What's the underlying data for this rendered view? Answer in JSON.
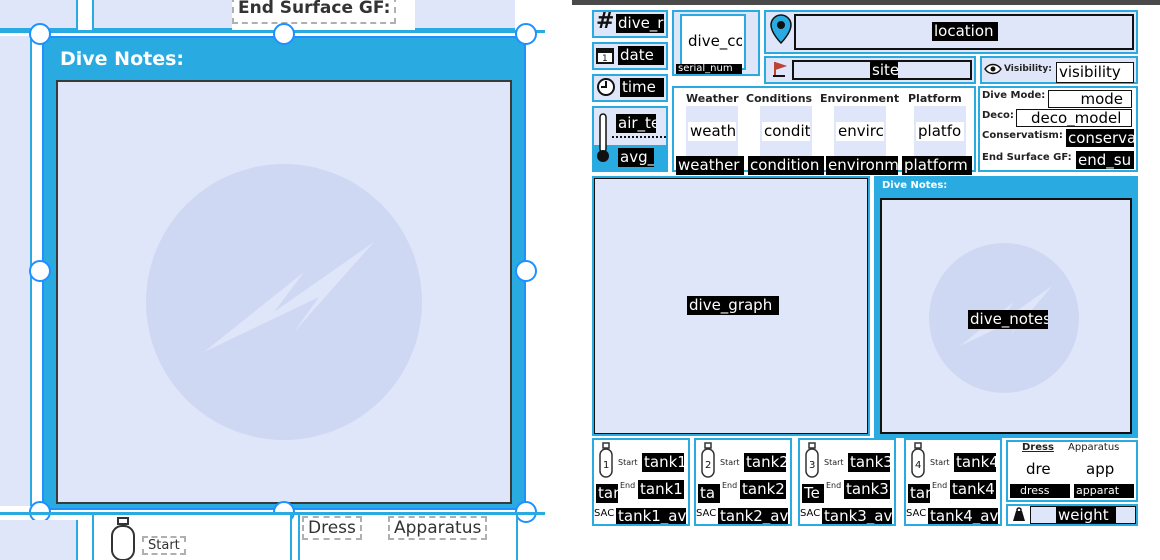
{
  "zoom": {
    "top_label": "End Surface GF:",
    "notes_title": "Dive Notes:",
    "dress": "Dress",
    "apparatus": "Apparatus",
    "start": "Start"
  },
  "header": {
    "dive_number": "dive_r",
    "date": "date",
    "time": "time",
    "dive_computer": "dive_co",
    "serial": "serial_num",
    "location": "location",
    "site": "site",
    "visibility_label": "Visibility:",
    "visibility": "visibility"
  },
  "temps": {
    "air": "air_te",
    "avg": "avg_t"
  },
  "conditions": {
    "headers": [
      "Weather",
      "Conditions",
      "Environment",
      "Platform"
    ],
    "values": [
      "weath",
      "condit",
      "envirc",
      "platfo"
    ],
    "extra": [
      "weather",
      "condition",
      "environm",
      "platform"
    ]
  },
  "deco": {
    "mode_label": "Dive Mode:",
    "mode": "mode",
    "deco_label": "Deco:",
    "deco_model": "deco_model",
    "conservatism_label": "Conservatism:",
    "conservatism": "conserva",
    "gf_label": "End Surface GF:",
    "gf": "end_su"
  },
  "main": {
    "graph": "dive_graph",
    "notes_title": "Dive Notes:",
    "notes": "dive_notes"
  },
  "tanks": [
    {
      "num": "1",
      "start_label": "Start",
      "start": "tank1",
      "gas": "tar",
      "end_label": "End",
      "end": "tank1",
      "sac_label": "SAC",
      "sac": "tank1_av"
    },
    {
      "num": "2",
      "start_label": "Start",
      "start": "tank2",
      "gas": "ta",
      "end_label": "End",
      "end": "tank2",
      "sac_label": "SAC",
      "sac": "tank2_av"
    },
    {
      "num": "3",
      "start_label": "Start",
      "start": "tank3",
      "gas": "Te",
      "end_label": "End",
      "end": "tank3",
      "sac_label": "SAC",
      "sac": "tank3_av"
    },
    {
      "num": "4",
      "start_label": "Start",
      "start": "tank4",
      "gas": "tar",
      "end_label": "End",
      "end": "tank4",
      "sac_label": "SAC",
      "sac": "tank4_av"
    }
  ],
  "gear": {
    "dress_label": "Dress",
    "apparatus_label": "Apparatus",
    "dress": "dre",
    "apparatus": "app",
    "dress_extra": "dress",
    "apparatus_extra": "apparat",
    "weight": "weight"
  },
  "colors": {
    "accent": "#29abe2",
    "fill": "#dfe6fa",
    "handle": "#1e90ff"
  }
}
